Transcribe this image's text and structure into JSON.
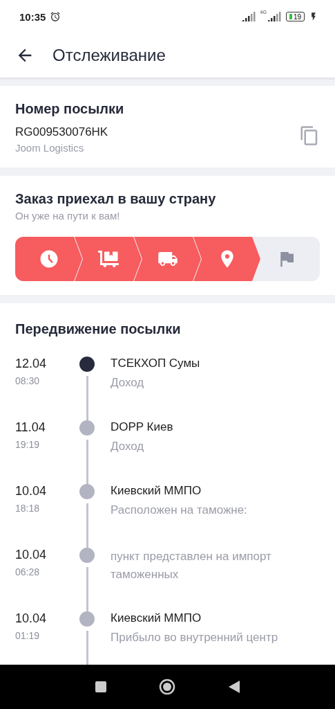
{
  "status_bar": {
    "time": "10:35",
    "network": "4G",
    "battery": "19"
  },
  "header": {
    "title": "Отслеживание"
  },
  "parcel": {
    "title": "Номер посылки",
    "number": "RG009530076HK",
    "carrier": "Joom Logistics"
  },
  "status": {
    "title": "Заказ приехал в вашу страну",
    "subtitle": "Он уже на пути к вам!",
    "steps": [
      {
        "done": true
      },
      {
        "done": true
      },
      {
        "done": true
      },
      {
        "done": true
      },
      {
        "done": false
      }
    ]
  },
  "movement": {
    "title": "Передвижение посылки",
    "events": [
      {
        "date": "12.04",
        "time": "08:30",
        "place": "ТСЕКХОП Сумы",
        "description": "Доход",
        "current": true
      },
      {
        "date": "11.04",
        "time": "19:19",
        "place": "DOPP Киев",
        "description": "Доход",
        "current": false
      },
      {
        "date": "10.04",
        "time": "18:18",
        "place": "Киевский ММПО",
        "description": "Расположен на таможне:",
        "current": false
      },
      {
        "date": "10.04",
        "time": "06:28",
        "description": "пункт представлен на импорт таможенных",
        "current": false
      },
      {
        "date": "10.04",
        "time": "01:19",
        "place": "Киевский ММПО",
        "description": "Прибыло во внутренний центр",
        "current": false
      }
    ]
  }
}
